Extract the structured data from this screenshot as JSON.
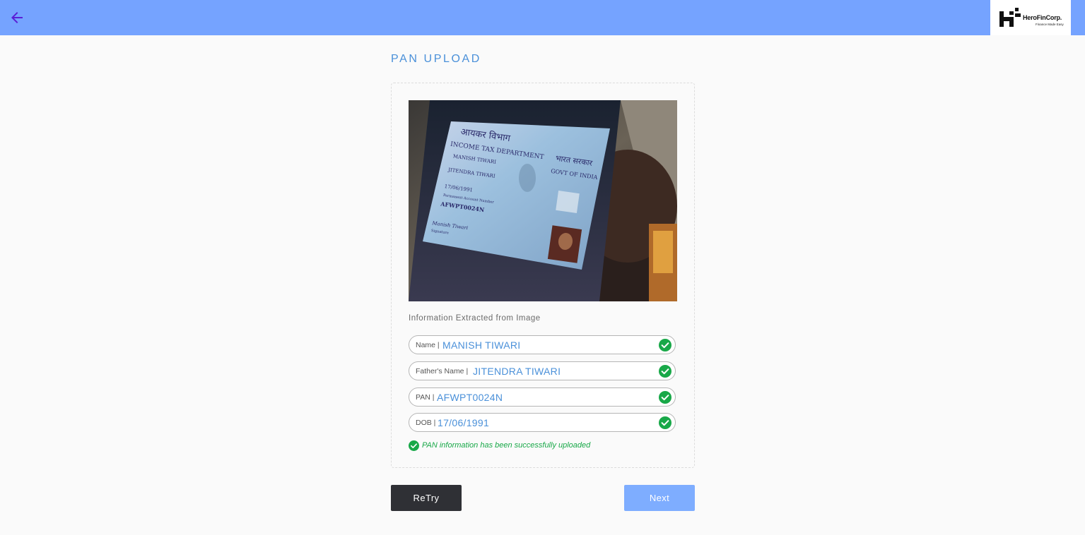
{
  "header": {
    "logo_name": "HeroFinCorp.",
    "logo_tagline": "Finance Made Easy"
  },
  "page": {
    "title": "PAN UPLOAD"
  },
  "card": {
    "section_label": "Information Extracted from Image",
    "fields": [
      {
        "label": "Name |",
        "value": "MANISH TIWARI"
      },
      {
        "label": "Father's Name |",
        "value": "JITENDRA TIWARI"
      },
      {
        "label": "PAN |",
        "value": "AFWPT0024N"
      },
      {
        "label": "DOB |",
        "value": "17/06/1991"
      }
    ],
    "success_message": "PAN information has been successfully uploaded",
    "photo": {
      "card_text": {
        "hindi_dept": "आयकर विभाग",
        "dept": "INCOME TAX DEPARTMENT",
        "hindi_govt": "भारत सरकार",
        "govt": "GOVT OF INDIA",
        "name": "MANISH TIWARI",
        "father": "JITENDRA TIWARI",
        "dob": "17/06/1991",
        "pan_caption": "Permanent Account Number",
        "pan": "AFWPT0024N",
        "sign": "Manish Tiwari",
        "sign_caption": "Signature"
      }
    }
  },
  "buttons": {
    "retry": "ReTry",
    "next": "Next"
  },
  "colors": {
    "header_bg": "#75a3ff",
    "accent": "#4a90d9",
    "success": "#18a848",
    "retry_bg": "#2f3035",
    "next_bg": "#7eadff"
  }
}
